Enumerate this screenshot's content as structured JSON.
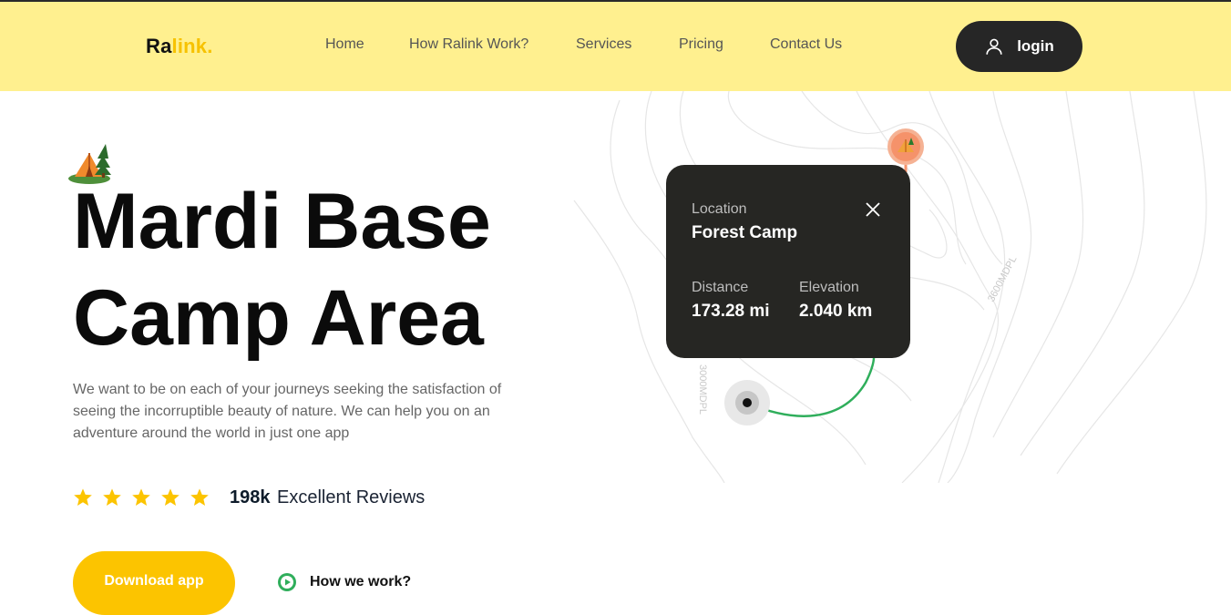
{
  "nav": {
    "logo_part1": "Ra",
    "logo_part2": "link.",
    "items": [
      "Home",
      "How Ralink Work?",
      "Services",
      "Pricing",
      "Contact Us"
    ],
    "login_label": "login",
    "user_icon": "user-icon"
  },
  "hero": {
    "icon": "tent-icon",
    "title_line1": "Mardi Base",
    "title_line2": "Camp Area",
    "description": "We want to be on each of your journeys seeking the satisfaction of seeing the incorruptible beauty of nature. We can help you on an adventure around the world in just one app",
    "rating_stars": 5,
    "review_count": "198k",
    "review_label": "Excellent Reviews",
    "download_label": "Download app",
    "how_label": "How we work?"
  },
  "map": {
    "contour_label_1": "3600MDPL",
    "contour_label_2": "3000MDPL",
    "card": {
      "location_label": "Location",
      "location_value": "Forest Camp",
      "distance_label": "Distance",
      "distance_value": "173.28 mi",
      "elevation_label": "Elevation",
      "elevation_value": "2.040 km"
    }
  },
  "colors": {
    "nav_bg": "#fff08f",
    "accent_yellow": "#fcc400",
    "dark": "#262626",
    "route_green": "#2fae5b",
    "pin_orange": "#f5926a"
  }
}
